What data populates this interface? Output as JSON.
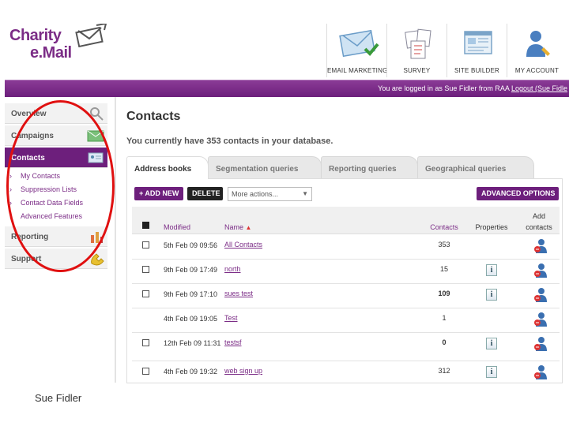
{
  "logo": {
    "line1": "Charity",
    "line2": "e.Mail"
  },
  "topnav": [
    {
      "label": "EMAIL MARKETING",
      "icon": "email-envelope-icon"
    },
    {
      "label": "SURVEY",
      "icon": "survey-icon"
    },
    {
      "label": "SITE BUILDER",
      "icon": "site-builder-icon"
    },
    {
      "label": "MY ACCOUNT",
      "icon": "user-account-icon"
    }
  ],
  "status": {
    "prefix": "You are logged in as Sue Fidler from RAA",
    "logout": "Logout (Sue Fidle"
  },
  "sidebar": {
    "items": [
      {
        "label": "Overview",
        "icon": "magnifier-icon"
      },
      {
        "label": "Campaigns",
        "icon": "envelope-icon"
      },
      {
        "label": "Contacts",
        "icon": "contacts-card-icon"
      },
      {
        "label": "Reporting",
        "icon": "bar-chart-icon"
      },
      {
        "label": "Support",
        "icon": "phone-icon"
      }
    ],
    "subitems": [
      "My Contacts",
      "Suppression Lists",
      "Contact Data Fields",
      "Advanced Features"
    ]
  },
  "main": {
    "title": "Contacts",
    "subtitle": "You currently have 353 contacts in your database.",
    "tabs": [
      "Address books",
      "Segmentation queries",
      "Reporting queries",
      "Geographical queries"
    ],
    "toolbar": {
      "add": "+ ADD NEW",
      "delete": "DELETE",
      "more": "More actions...",
      "advanced": "ADVANCED OPTIONS"
    },
    "columns": {
      "modified": "Modified",
      "name": "Name",
      "contacts": "Contacts",
      "properties": "Properties",
      "add_line1": "Add",
      "add_line2": "contacts"
    },
    "rows": [
      {
        "modified": "5th Feb 09 09:56",
        "name": "All Contacts",
        "contacts": "353",
        "bold": false,
        "checkbox": true,
        "info": false
      },
      {
        "modified": "9th Feb 09 17:49",
        "name": "north",
        "contacts": "15",
        "bold": false,
        "checkbox": true,
        "info": true
      },
      {
        "modified": "9th Feb 09 17:10",
        "name": "sues test",
        "contacts": "109",
        "bold": true,
        "checkbox": true,
        "info": true
      },
      {
        "modified": "4th Feb 09 19:05",
        "name": "Test",
        "contacts": "1",
        "bold": false,
        "checkbox": false,
        "info": false
      },
      {
        "modified": "12th Feb 09 11:31",
        "name": "testsf",
        "contacts": "0",
        "bold": true,
        "checkbox": true,
        "info": true
      },
      {
        "modified": "4th Feb 09 19:32",
        "name": "web sign up",
        "contacts": "312",
        "bold": false,
        "checkbox": true,
        "info": true
      }
    ]
  },
  "footer": {
    "name": "Sue Fidler"
  },
  "colors": {
    "brand": "#6d1f7c",
    "annotation": "#e01010"
  }
}
